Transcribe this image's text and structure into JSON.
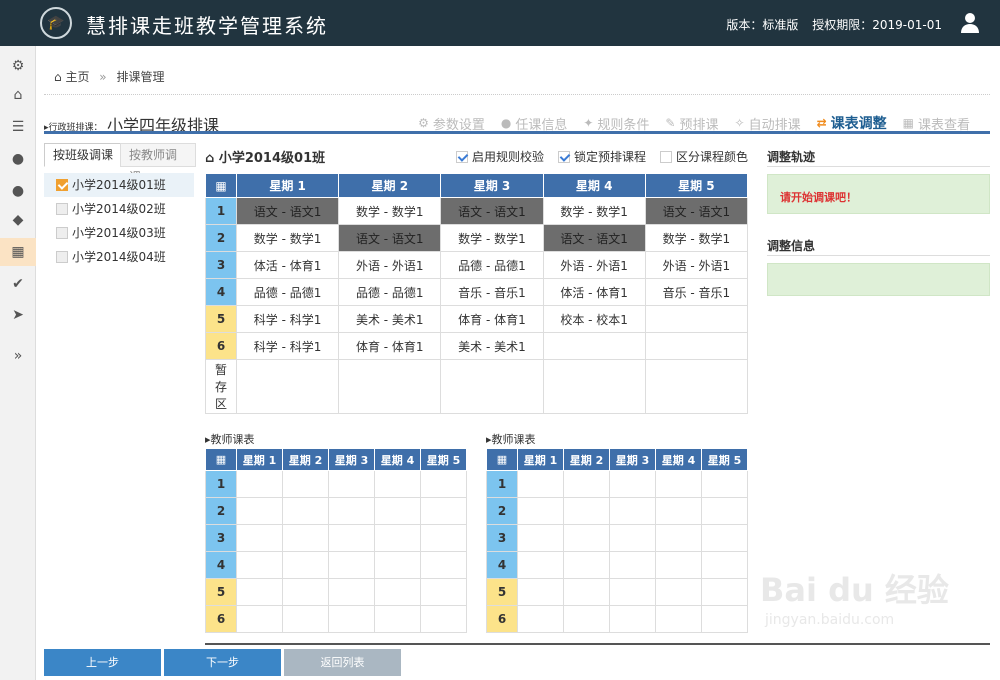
{
  "header": {
    "app_title": "慧排课走班教学管理系统",
    "version_label": "版本：标准版",
    "license_label": "授权期限：2019-01-01"
  },
  "icons": {
    "sidebar": [
      "gear-icon",
      "home-icon",
      "list-icon",
      "user-icon",
      "user-icon",
      "tag-icon",
      "film-icon",
      "check-icon",
      "location-arrow-icon",
      "double-chevron-right-icon"
    ]
  },
  "breadcrumb": {
    "home": "主页",
    "current": "排课管理"
  },
  "section": {
    "label": "行政班排课：",
    "title": "小学四年级排课"
  },
  "steps": [
    {
      "label": "参数设置",
      "active": false
    },
    {
      "label": "任课信息",
      "active": false
    },
    {
      "label": "规则条件",
      "active": false
    },
    {
      "label": "预排课",
      "active": false
    },
    {
      "label": "自动排课",
      "active": false
    },
    {
      "label": "课表调整",
      "active": true
    },
    {
      "label": "课表查看",
      "active": false
    }
  ],
  "tabs": {
    "by_class": "按班级调课",
    "by_teacher": "按教师调课"
  },
  "classes": [
    "小学2014级01班",
    "小学2014级02班",
    "小学2014级03班",
    "小学2014级04班"
  ],
  "schedule": {
    "title": "小学2014级01班",
    "options": [
      "启用规则校验",
      "锁定预排课程",
      "区分课程颜色"
    ],
    "days": [
      "星期 1",
      "星期 2",
      "星期 3",
      "星期 4",
      "星期 5"
    ],
    "periods": [
      "1",
      "2",
      "3",
      "4",
      "5",
      "6"
    ],
    "rows": [
      [
        "语文 - 语文1",
        "数学 - 数学1",
        "语文 - 语文1",
        "数学 - 数学1",
        "语文 - 语文1"
      ],
      [
        "数学 - 数学1",
        "语文 - 语文1",
        "数学 - 数学1",
        "语文 - 语文1",
        "数学 - 数学1"
      ],
      [
        "体活 - 体育1",
        "外语 - 外语1",
        "品德 - 品德1",
        "外语 - 外语1",
        "外语 - 外语1"
      ],
      [
        "品德 - 品德1",
        "品德 - 品德1",
        "音乐 - 音乐1",
        "体活 - 体育1",
        "音乐 - 音乐1"
      ],
      [
        "科学 - 科学1",
        "美术 - 美术1",
        "体育 - 体育1",
        "校本 - 校本1",
        ""
      ],
      [
        "科学 - 科学1",
        "体育 - 体育1",
        "美术 - 美术1",
        "",
        ""
      ]
    ],
    "staging_label": [
      "暂",
      "存",
      "区"
    ]
  },
  "teacher_tables": {
    "title": "教师课表",
    "days": [
      "星期 1",
      "星期 2",
      "星期 3",
      "星期 4",
      "星期 5"
    ],
    "periods": [
      "1",
      "2",
      "3",
      "4",
      "5",
      "6"
    ]
  },
  "right_panel": {
    "trace_title": "调整轨迹",
    "trace_msg": "请开始调课吧！",
    "info_title": "调整信息"
  },
  "buttons": {
    "prev": "上一步",
    "next": "下一步",
    "back": "返回列表"
  },
  "watermark": {
    "brand": "Bai du 经验",
    "url": "jingyan.baidu.com"
  },
  "colors": {
    "header_bg": "#21343f",
    "table_head": "#3f6faa",
    "period_blue": "#7cc4ef",
    "period_yellow": "#fce38a",
    "locked_cell": "#6d6d6d",
    "accent_orange": "#f08c1e"
  }
}
